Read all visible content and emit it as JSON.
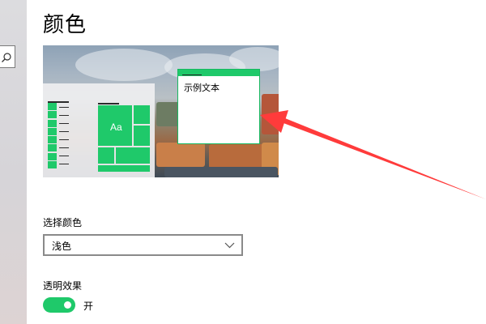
{
  "page": {
    "title": "颜色"
  },
  "nav": {
    "search_icon": "search-icon"
  },
  "preview": {
    "sample_window_text": "示例文本",
    "tile_text": "Aa",
    "accent_color": "#1fc96a"
  },
  "choose_color": {
    "label": "选择颜色",
    "selected": "浅色"
  },
  "transparency": {
    "label": "透明效果",
    "state_text": "开",
    "enabled": true
  },
  "annotation": {
    "arrow_color": "#ff3b3b"
  }
}
